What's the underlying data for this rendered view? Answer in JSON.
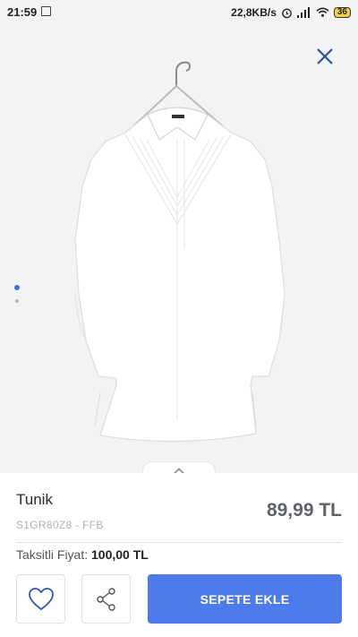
{
  "status_bar": {
    "time": "21:59",
    "network_speed": "22,8KB/s",
    "battery": "36"
  },
  "product": {
    "name": "Tunik",
    "code": "S1GR80Z8 - FFB",
    "price": "89,99 TL",
    "installment_label": "Taksitli Fiyat:",
    "installment_price": "100,00 TL",
    "image_count": 2,
    "active_image_index": 0
  },
  "actions": {
    "add_to_cart_label": "SEPETE EKLE",
    "favorite_icon": "heart-icon",
    "share_icon": "share-icon",
    "close_icon": "close-icon",
    "collapse_icon": "chevron-up-icon"
  },
  "colors": {
    "accent": "#4d7bea",
    "image_background": "#f3f3f3",
    "price_text": "#5f6269"
  }
}
